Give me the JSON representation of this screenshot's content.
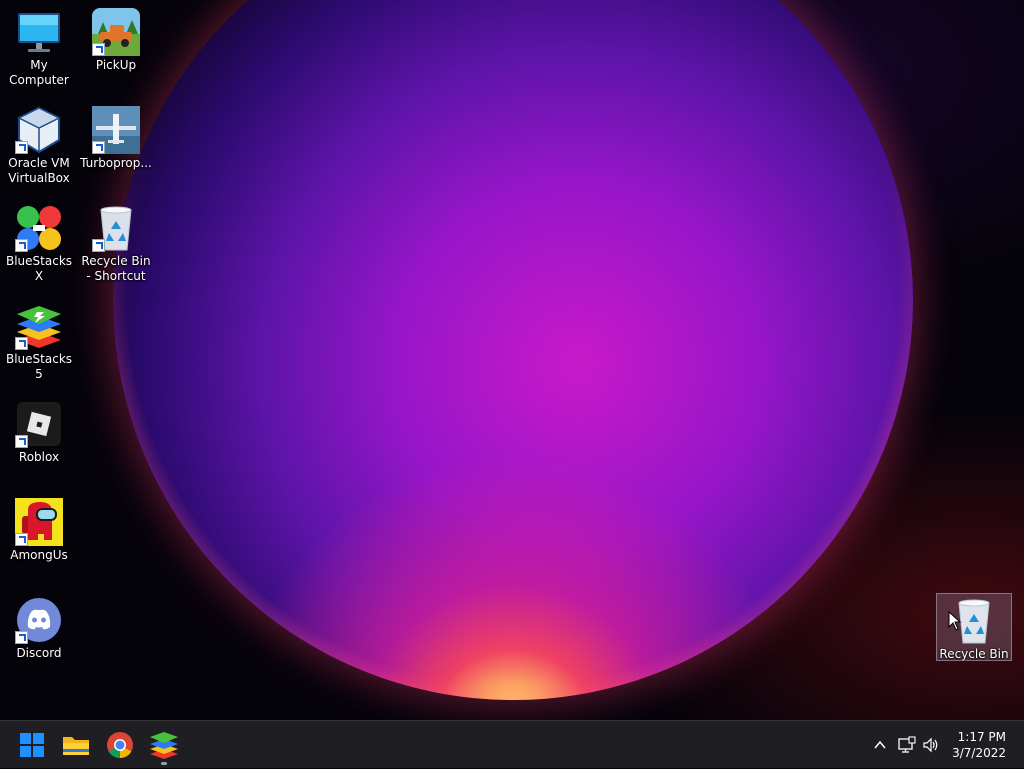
{
  "desktop": {
    "icons": [
      {
        "id": "my-computer",
        "label": "My Computer"
      },
      {
        "id": "pickup",
        "label": "PickUp"
      },
      {
        "id": "virtualbox",
        "label": "Oracle VM VirtualBox"
      },
      {
        "id": "turboprop",
        "label": "Turboprop..."
      },
      {
        "id": "bluestacks-x",
        "label": "BlueStacks X"
      },
      {
        "id": "recycle-bin-shortcut",
        "label": "Recycle Bin - Shortcut"
      },
      {
        "id": "bluestacks-5",
        "label": "BlueStacks 5"
      },
      {
        "id": "roblox",
        "label": "Roblox"
      },
      {
        "id": "among-us",
        "label": "AmongUs"
      },
      {
        "id": "discord",
        "label": "Discord"
      },
      {
        "id": "recycle-bin",
        "label": "Recycle Bin"
      }
    ]
  },
  "taskbar": {
    "apps": [
      "start-icon",
      "file-explorer-icon",
      "chrome-icon",
      "bluestacks-icon"
    ],
    "tray": [
      "chevron-up-icon",
      "network-icon",
      "volume-icon"
    ],
    "clock": {
      "time": "1:17 PM",
      "date": "3/7/2022"
    }
  },
  "colors": {
    "taskbar": "#1f1f23",
    "orb_core": "#c819c9",
    "start_blue": "#1e90ff"
  }
}
